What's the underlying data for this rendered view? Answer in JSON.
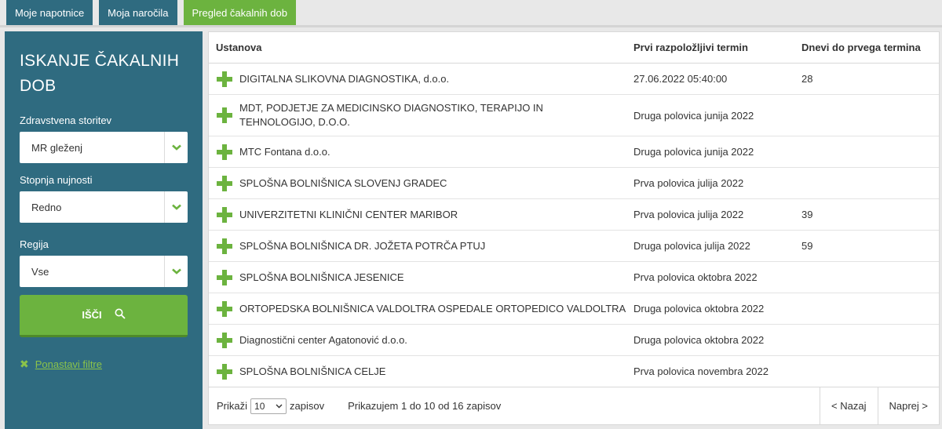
{
  "tabs": [
    {
      "label": "Moje napotnice"
    },
    {
      "label": "Moja naročila"
    },
    {
      "label": "Pregled čakalnih dob"
    }
  ],
  "sidebar": {
    "title": "ISKANJE ČAKALNIH DOB",
    "service_label": "Zdravstvena storitev",
    "service_value": "MR gleženj",
    "urgency_label": "Stopnja nujnosti",
    "urgency_value": "Redno",
    "region_label": "Regija",
    "region_value": "Vse",
    "search_label": "IŠČI",
    "reset_label": "Ponastavi filtre"
  },
  "table": {
    "headers": [
      "Ustanova",
      "Prvi razpoložljivi termin",
      "Dnevi do prvega termina"
    ],
    "rows": [
      {
        "name": "DIGITALNA SLIKOVNA DIAGNOSTIKA, d.o.o.",
        "term": "27.06.2022 05:40:00",
        "days": "28"
      },
      {
        "name": "MDT, PODJETJE ZA MEDICINSKO DIAGNOSTIKO, TERAPIJO IN TEHNOLOGIJO, D.O.O.",
        "term": "Druga polovica junija 2022",
        "days": ""
      },
      {
        "name": "MTC Fontana d.o.o.",
        "term": "Druga polovica junija 2022",
        "days": ""
      },
      {
        "name": "SPLOŠNA BOLNIŠNICA SLOVENJ GRADEC",
        "term": "Prva polovica julija 2022",
        "days": ""
      },
      {
        "name": "UNIVERZITETNI KLINIČNI CENTER MARIBOR",
        "term": "Prva polovica julija 2022",
        "days": "39"
      },
      {
        "name": "SPLOŠNA BOLNIŠNICA DR. JOŽETA POTRČA PTUJ",
        "term": "Druga polovica julija 2022",
        "days": "59"
      },
      {
        "name": "SPLOŠNA BOLNIŠNICA JESENICE",
        "term": "Prva polovica oktobra 2022",
        "days": ""
      },
      {
        "name": "ORTOPEDSKA BOLNIŠNICA VALDOLTRA OSPEDALE ORTOPEDICO VALDOLTRA",
        "term": "Druga polovica oktobra 2022",
        "days": ""
      },
      {
        "name": "Diagnostični center Agatonović d.o.o.",
        "term": "Druga polovica oktobra 2022",
        "days": ""
      },
      {
        "name": "SPLOŠNA BOLNIŠNICA CELJE",
        "term": "Prva polovica novembra 2022",
        "days": ""
      }
    ]
  },
  "footer": {
    "show_label": "Prikaži",
    "page_size": "10",
    "records_label": "zapisov",
    "info": "Prikazujem 1 do 10 od 16 zapisov",
    "prev": "< Nazaj",
    "next": "Naprej >"
  },
  "icons": {
    "expand": "plus-icon",
    "dropdown": "chevron-down-icon",
    "search": "search-icon",
    "reset": "close-icon"
  },
  "colors": {
    "primary": "#2f6b80",
    "accent": "#6cb33f"
  }
}
